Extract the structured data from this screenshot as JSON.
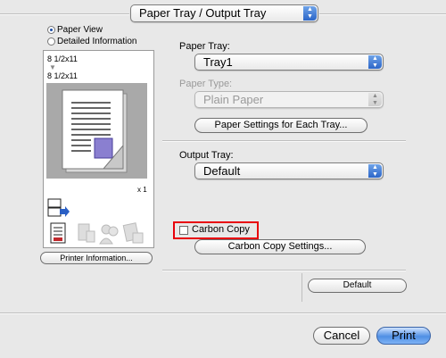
{
  "header": {
    "panel_selector": "Paper Tray / Output Tray"
  },
  "view_options": {
    "paper_view": "Paper View",
    "detailed_information": "Detailed Information",
    "selected": "Paper View"
  },
  "preview": {
    "source_size": "8 1/2x11",
    "output_size": "8 1/2x11",
    "copies": "x 1"
  },
  "icons": [
    "output-tray-icon",
    "document-icon",
    "secure-print-icon",
    "user-auth-icon",
    "account-track-icon"
  ],
  "printer_information_button": "Printer Information...",
  "paper_tray": {
    "label": "Paper Tray:",
    "value": "Tray1"
  },
  "paper_type": {
    "label": "Paper Type:",
    "value": "Plain Paper"
  },
  "paper_settings_button": "Paper Settings for Each Tray...",
  "output_tray": {
    "label": "Output Tray:",
    "value": "Default"
  },
  "carbon_copy": {
    "label": "Carbon Copy",
    "checked": false,
    "highlight_color": "#e8000b"
  },
  "carbon_copy_settings_button": "Carbon Copy Settings...",
  "default_button": "Default",
  "footer": {
    "cancel": "Cancel",
    "print": "Print"
  },
  "colors": {
    "accent": "#4f8fe4",
    "background": "#e8e8e8"
  }
}
